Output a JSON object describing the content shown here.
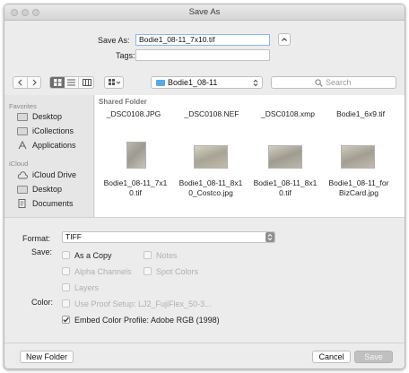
{
  "window": {
    "title": "Save As"
  },
  "save_as": {
    "label": "Save As:",
    "value": "Bodie1_08-11_7x10.tif"
  },
  "tags": {
    "label": "Tags:",
    "value": ""
  },
  "toolbar": {
    "location": "Bodie1_08-11",
    "search_placeholder": "Search"
  },
  "sidebar": {
    "favorites_header": "Favorites",
    "favorites": [
      {
        "label": "Desktop",
        "icon": "desktop-folder-icon"
      },
      {
        "label": "iCollections",
        "icon": "folder-icon"
      },
      {
        "label": "Applications",
        "icon": "applications-icon"
      }
    ],
    "icloud_header": "iCloud",
    "icloud": [
      {
        "label": "iCloud Drive",
        "icon": "cloud-icon"
      },
      {
        "label": "Desktop",
        "icon": "desktop-folder-icon"
      },
      {
        "label": "Documents",
        "icon": "documents-icon"
      }
    ]
  },
  "files": {
    "header": "Shared Folder",
    "top_row": [
      "_DSC0108.JPG",
      "_DSC0108.NEF",
      "_DSC0108.xmp",
      "Bodie1_6x9.tif"
    ],
    "items": [
      {
        "line1": "Bodie1_08-11_7x1",
        "line2": "0.tif"
      },
      {
        "line1": "Bodie1_08-11_8x1",
        "line2": "0_Costco.jpg"
      },
      {
        "line1": "Bodie1_08-11_8x1",
        "line2": "0.tif"
      },
      {
        "line1": "Bodie1_08-11_for",
        "line2": "BizCard.jpg"
      }
    ]
  },
  "options": {
    "format_label": "Format:",
    "format_value": "TIFF",
    "save_label": "Save:",
    "as_a_copy": "As a Copy",
    "notes": "Notes",
    "alpha_channels": "Alpha Channels",
    "spot_colors": "Spot Colors",
    "layers": "Layers",
    "color_label": "Color:",
    "use_proof_setup": "Use Proof Setup:  LJ2_FujiFlex_50-3...",
    "embed_color_profile": "Embed Color Profile:  Adobe RGB (1998)"
  },
  "buttons": {
    "new_folder": "New Folder",
    "cancel": "Cancel",
    "save": "Save"
  },
  "colors": {
    "accent": "#3b8ff5",
    "disabled_button": "#c0c0c0",
    "folder_blue": "#5aa9e6"
  }
}
